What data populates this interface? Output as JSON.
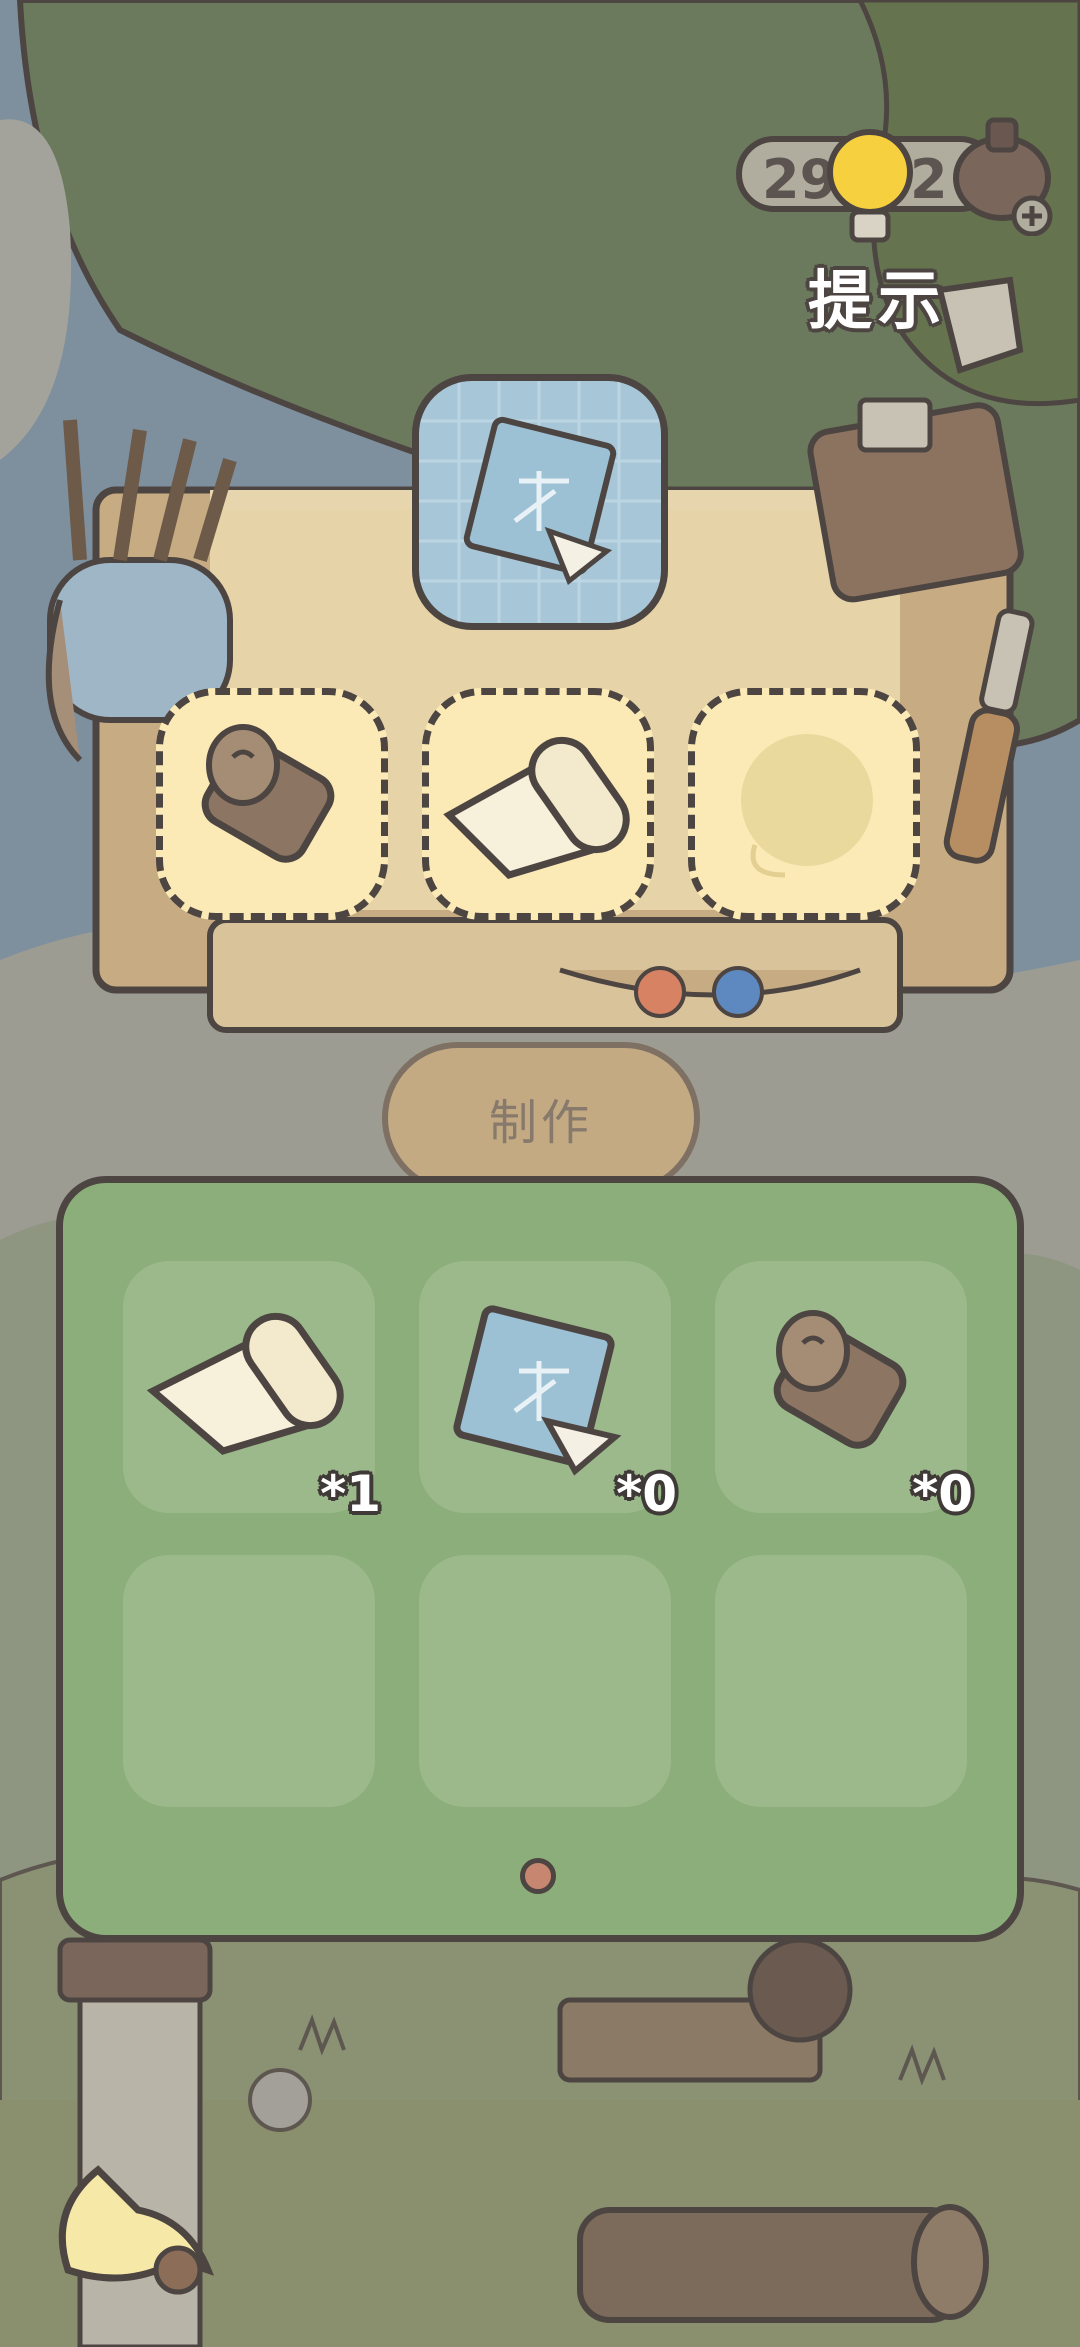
{
  "hint": {
    "count_left": "29",
    "count_right": "2",
    "label": "提示"
  },
  "target": {
    "item": "blueprint-scroll-icon"
  },
  "slots": [
    {
      "filled": true,
      "item": "wood-log-icon"
    },
    {
      "filled": true,
      "item": "paper-roll-icon"
    },
    {
      "filled": false,
      "item": "thread-ball-icon"
    }
  ],
  "make_button": {
    "label": "制作",
    "enabled": false
  },
  "inventory": {
    "items": [
      {
        "item": "paper-roll-icon",
        "count": "*1"
      },
      {
        "item": "blueprint-scroll-icon",
        "count": "*0"
      },
      {
        "item": "wood-log-icon",
        "count": "*0"
      }
    ],
    "page_count": 1,
    "current_page": 1
  },
  "colors": {
    "panel": "#8cae7a",
    "slot": "#fbeab6",
    "outline": "#4d4542",
    "page_dot": "#c78670"
  }
}
